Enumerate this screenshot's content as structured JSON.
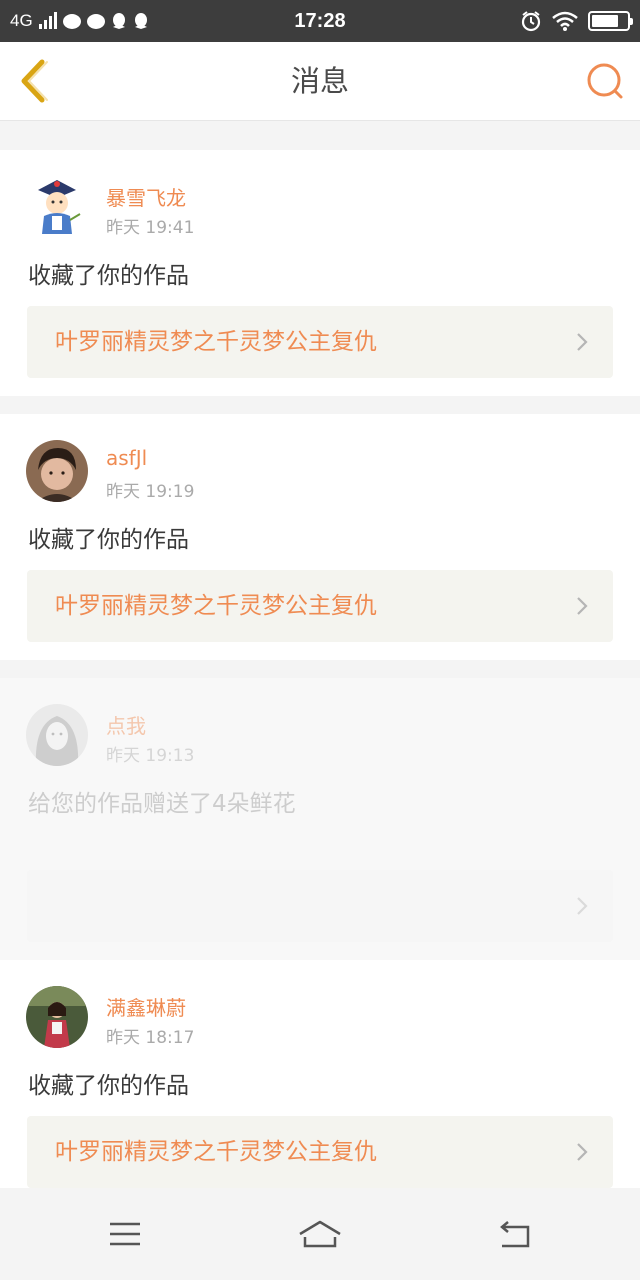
{
  "status_bar": {
    "network": "4G",
    "time": "17:28"
  },
  "header": {
    "title": "消息"
  },
  "messages": [
    {
      "username": "暴雪飞龙",
      "time": "昨天 19:41",
      "action": "收藏了你的作品",
      "work_title": "叶罗丽精灵梦之千灵梦公主复仇",
      "read": false
    },
    {
      "username": "asfJl",
      "time": "昨天 19:19",
      "action": "收藏了你的作品",
      "work_title": "叶罗丽精灵梦之千灵梦公主复仇",
      "read": false
    },
    {
      "username": "点我",
      "time": "昨天 19:13",
      "action": "给您的作品赠送了4朵鲜花",
      "work_title": "",
      "read": true
    },
    {
      "username": "满鑫琳蔚",
      "time": "昨天 18:17",
      "action": "收藏了你的作品",
      "work_title": "叶罗丽精灵梦之千灵梦公主复仇",
      "read": false
    }
  ],
  "colors": {
    "accent": "#ef8b52",
    "back_arrow": "#d9a514",
    "status_bar": "#3d3d3d"
  },
  "icons": {
    "back": "chevron-left-icon",
    "search": "search-icon",
    "item_arrow": "chevron-right-icon",
    "menu": "menu-icon",
    "home": "home-icon",
    "return": "return-icon"
  }
}
